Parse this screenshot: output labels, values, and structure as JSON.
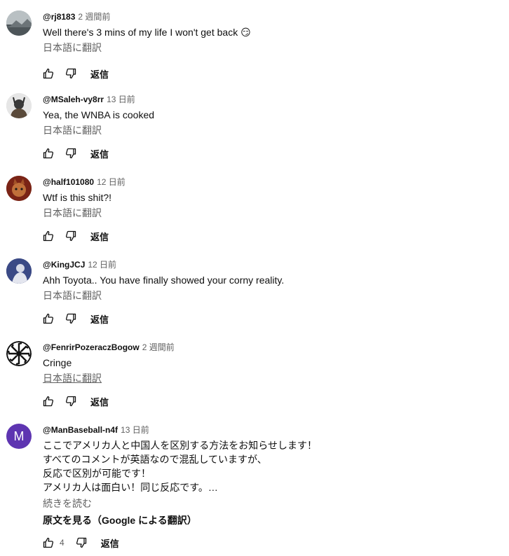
{
  "comments": [
    {
      "author": "@rj8183",
      "time": "2 週間前",
      "text": "Well there's 3 mins of my life I won't get back",
      "emoji": "😏",
      "translate": "日本語に翻訳",
      "reply": "返信"
    },
    {
      "author": "@MSaleh-vy8rr",
      "time": "13 日前",
      "text": "Yea, the WNBA is cooked",
      "translate": "日本語に翻訳",
      "reply": "返信"
    },
    {
      "author": "@half101080",
      "time": "12 日前",
      "text": "Wtf is this shit?!",
      "translate": "日本語に翻訳",
      "reply": "返信"
    },
    {
      "author": "@KingJCJ",
      "time": "12 日前",
      "text": "Ahh Toyota.. You have finally showed your corny reality.",
      "translate": "日本語に翻訳",
      "reply": "返信"
    },
    {
      "author": "@FenrirPozeraczBogow",
      "time": "2 週間前",
      "text": "Cringe",
      "translate": "日本語に翻訳",
      "reply": "返信"
    },
    {
      "author": "@ManBaseball-n4f",
      "time": "13 日前",
      "avatar_letter": "M",
      "lines": [
        "ここでアメリカ人と中国人を区別する方法をお知らせします！",
        "すべてのコメントが英語なので混乱していますが、",
        "反応で区別が可能です！",
        "アメリカ人は面白い！同じ反応です。…"
      ],
      "read_more": "続きを読む",
      "show_original": "原文を見る（Google による翻訳）",
      "like_count": "4",
      "reply": "返信"
    }
  ],
  "colors": {
    "text": "#0f0f0f",
    "secondary": "#606060",
    "avatar_m": "#5e35b1"
  },
  "icons": [
    "thumbs-up-icon",
    "thumbs-down-icon"
  ]
}
